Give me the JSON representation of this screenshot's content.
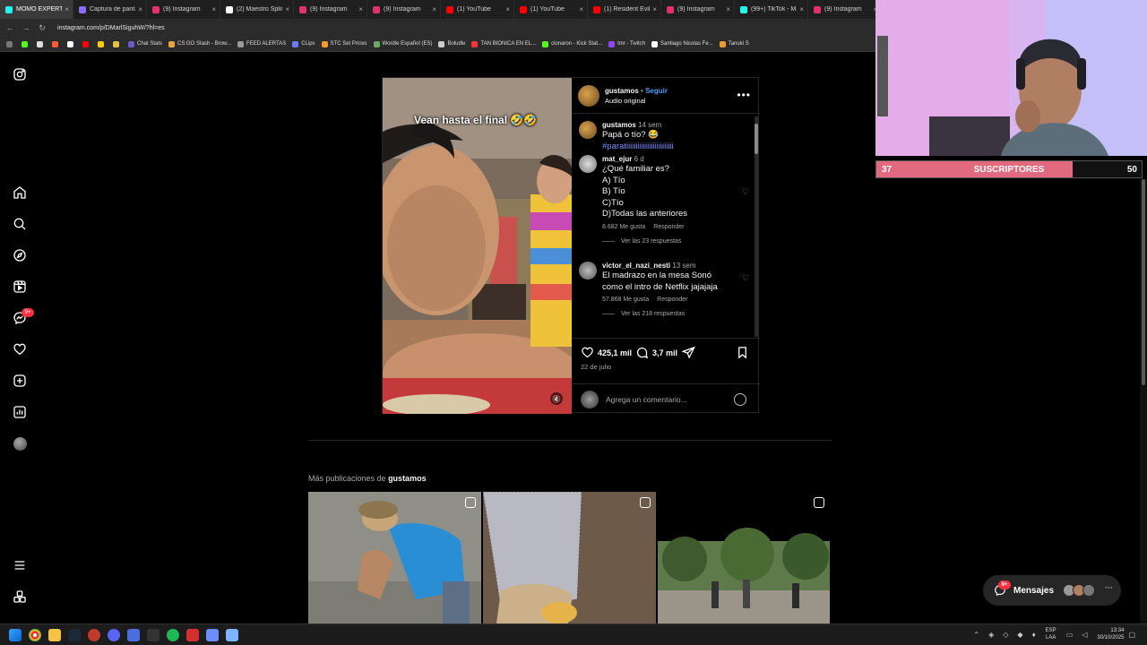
{
  "browser": {
    "tabs": [
      {
        "label": "MOMO EXPERTO",
        "color": "#25f4ee",
        "active": true
      },
      {
        "label": "Captura de panta",
        "color": "#8a6bff"
      },
      {
        "label": "(9) Instagram",
        "color": "#e1306c"
      },
      {
        "label": "(2) Maestro Splin",
        "color": "#ffffff"
      },
      {
        "label": "(9) Instagram",
        "color": "#e1306c"
      },
      {
        "label": "(9) Instagram",
        "color": "#e1306c"
      },
      {
        "label": "(1) YouTube",
        "color": "#ff0000"
      },
      {
        "label": "(1) YouTube",
        "color": "#ff0000"
      },
      {
        "label": "(1) Resident Evil",
        "color": "#ff0000"
      },
      {
        "label": "(9) Instagram",
        "color": "#e1306c"
      },
      {
        "label": "(99+) TikTok - Ma",
        "color": "#25f4ee"
      },
      {
        "label": "(9) Instagram",
        "color": "#e1306c"
      }
    ],
    "url": "instagram.com/p/DMarlSiguhW/?hl=es",
    "bookmarks": [
      {
        "label": "Chat Stats",
        "color": "#6a5acd"
      },
      {
        "label": "CS:GO Stash - Brow...",
        "color": "#e8a33c"
      },
      {
        "label": "FEED ALERTAS",
        "color": "#999999"
      },
      {
        "label": "CLips",
        "color": "#6a7cff"
      },
      {
        "label": "STC Set Prices",
        "color": "#f29b2b"
      },
      {
        "label": "Wordle Español (ES)",
        "color": "#6aaa64"
      },
      {
        "label": "Boludle",
        "color": "#cccccc"
      },
      {
        "label": "TAN BIONICA EN EL...",
        "color": "#ff3333"
      },
      {
        "label": "cionaron - Kick Stat...",
        "color": "#53fc18"
      },
      {
        "label": "tmr - Twitch",
        "color": "#9146ff"
      },
      {
        "label": "Santiago Nicolas Fe...",
        "color": "#ffffff"
      },
      {
        "label": "Tanuki S",
        "color": "#f29b2b"
      }
    ]
  },
  "nav": {
    "badge": "9+"
  },
  "post": {
    "username": "gustamos",
    "follow_label": "Seguir",
    "audio": "Audio original",
    "video_caption": "Vean hasta el final 🤣🤣",
    "caption_comment": {
      "user": "gustamos",
      "time": "14 sem",
      "text": "Papá o tío? 😂 ",
      "tag": "#paratiiiiiiiiiiiiiiiiiiiiiiiii"
    },
    "comments": [
      {
        "user": "mat_ejur",
        "time": "6 d",
        "lines": [
          "¿Qué familiar es?",
          "A) Tío",
          "B) Tío",
          "C)Tío",
          "D)Todas las anteriores"
        ],
        "likes": "8.682 Me gusta",
        "reply": "Responder",
        "replies": "Ver las 23 respuestas"
      },
      {
        "user": "victor_el_nazi_nesti",
        "time": "13 sem",
        "lines": [
          "El madrazo en la mesa Sonó",
          "como el intro de Netflix jajajaja"
        ],
        "likes": "57.868 Me gusta",
        "reply": "Responder",
        "replies": "Ver las 218 respuestas"
      }
    ],
    "like_count": "425,1 mil",
    "comment_count": "3,7 mil",
    "date": "22 de julio",
    "comment_placeholder": "Agrega un comentario..."
  },
  "more": {
    "prefix": "Más publicaciones de ",
    "user": "gustamos"
  },
  "messages": {
    "label": "Mensajes",
    "badge": "9+"
  },
  "stream": {
    "current": "37",
    "label": "SUSCRIPTORES",
    "goal": "50",
    "progress_fraction": 0.74,
    "bar_color": "#e26a7e"
  },
  "taskbar": {
    "lang_top": "ESP",
    "lang_bottom": "LAA",
    "time": "13:34",
    "date": "30/10/2025"
  }
}
